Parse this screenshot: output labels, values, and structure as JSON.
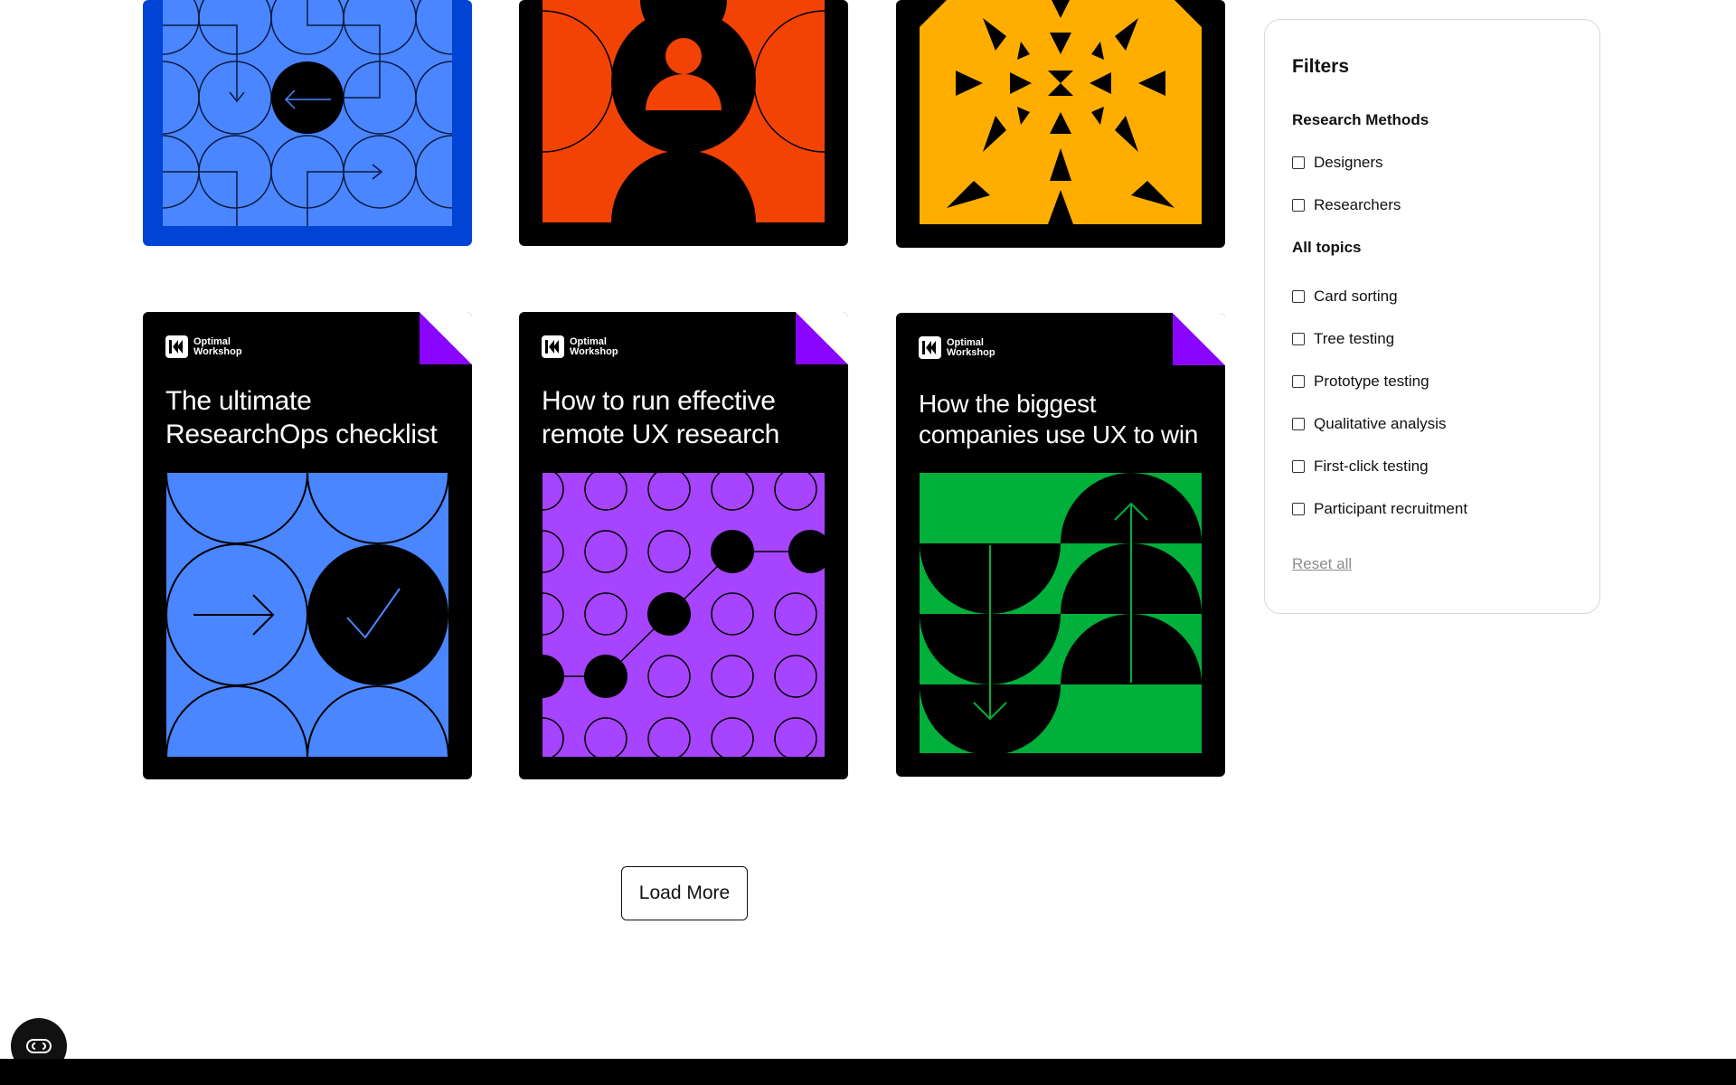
{
  "cards_top": [
    {
      "id": "blue-maze",
      "color": "#4a86ff"
    },
    {
      "id": "orange-person",
      "color": "#f24305"
    },
    {
      "id": "yellow-star",
      "color": "#ffae00"
    }
  ],
  "cards": [
    {
      "brand": "Optimal\nWorkshop",
      "title": "The ultimate ResearchOps checklist",
      "color": "#4a86ff"
    },
    {
      "brand": "Optimal\nWorkshop",
      "title": "How to run effective remote UX research",
      "color": "#a744ff"
    },
    {
      "brand": "Optimal\nWorkshop",
      "title": "How the biggest companies use UX to win",
      "color": "#00b03a"
    }
  ],
  "load_more": "Load More",
  "filters": {
    "title": "Filters",
    "research_methods": {
      "heading": "Research Methods",
      "options": [
        "Designers",
        "Researchers"
      ]
    },
    "topics": {
      "heading": "All topics",
      "options": [
        "Card sorting",
        "Tree testing",
        "Prototype testing",
        "Qualitative analysis",
        "First-click testing",
        "Participant recruitment"
      ]
    },
    "reset": "Reset all"
  },
  "chat_icon": "chat-icon"
}
